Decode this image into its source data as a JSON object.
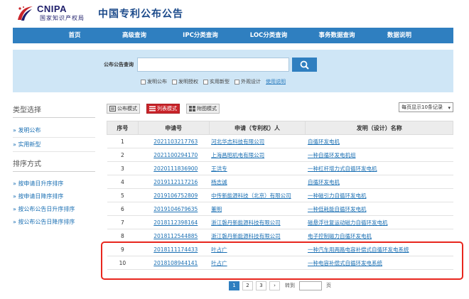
{
  "header": {
    "logo_text": "CNIPA",
    "logo_sub": "国家知识产权局",
    "title": "中国专利公布公告"
  },
  "nav": [
    "首页",
    "高级查询",
    "IPC分类查询",
    "LOC分类查询",
    "事务数据查询",
    "数据说明"
  ],
  "search": {
    "label": "公布公告查询",
    "value": "",
    "checks": [
      "发明公布",
      "发明授权",
      "实用新型",
      "外观设计"
    ],
    "help": "使用说明"
  },
  "sidebar": {
    "type_head": "类型选择",
    "types": [
      "» 发明公布",
      "» 实用新型"
    ],
    "sort_head": "排序方式",
    "sorts": [
      "» 按申请日升序排序",
      "» 按申请日降序排序",
      "» 按公布公告日升序排序",
      "» 按公布公告日降序排序"
    ]
  },
  "modes": {
    "publish": "公布模式",
    "list": "列表模式",
    "figure": "附图模式",
    "per_page": "每页显示10条记录"
  },
  "table": {
    "headers": [
      "序号",
      "申请号",
      "申请（专利权）人",
      "发明（设计）名称"
    ],
    "rows": [
      {
        "no": "1",
        "app": "2021103217763",
        "owner": "河北华志科技有限公司",
        "name": "自循环发电机"
      },
      {
        "no": "2",
        "app": "2021100294170",
        "owner": "上海昌昭机电有限公司",
        "name": "一种自循环发电机组"
      },
      {
        "no": "3",
        "app": "2020111836900",
        "owner": "王洪专",
        "name": "一种杠杆增力式自循环发电机"
      },
      {
        "no": "4",
        "app": "2019112117216",
        "owner": "杨志诚",
        "name": "自循环发电机"
      },
      {
        "no": "5",
        "app": "2019106752809",
        "owner": "中传新能源科技（北京）有限公司",
        "name": "一种磁引力自循环发电机"
      },
      {
        "no": "6",
        "app": "2019104679635",
        "owner": "董明",
        "name": "一种低耗能自循环发电机"
      },
      {
        "no": "7",
        "app": "2018112398164",
        "owner": "浙江磐丹新能源科技有限公司",
        "name": "磁悬浮往复运动磁力自循环发电机"
      },
      {
        "no": "8",
        "app": "2018112544885",
        "owner": "浙江磐丹新能源科技有限公司",
        "name": "电子控制磁力自循环发电机"
      },
      {
        "no": "9",
        "app": "2018111174433",
        "owner": "叶占广",
        "name": "一种汽车用两路电容补偿式自循环发电系统"
      },
      {
        "no": "10",
        "app": "2018108944141",
        "owner": "叶占广",
        "name": "一种电容补偿式自循环发电系统"
      }
    ]
  },
  "pager": {
    "pages": [
      "1",
      "2",
      "3"
    ],
    "next": "›",
    "goto": "转到",
    "page_unit": "页"
  },
  "colors": {
    "nav_blue": "#2f7fc0",
    "search_band": "#cfe6f6",
    "active_red": "#c9242a",
    "highlight_red": "#e8261e"
  }
}
